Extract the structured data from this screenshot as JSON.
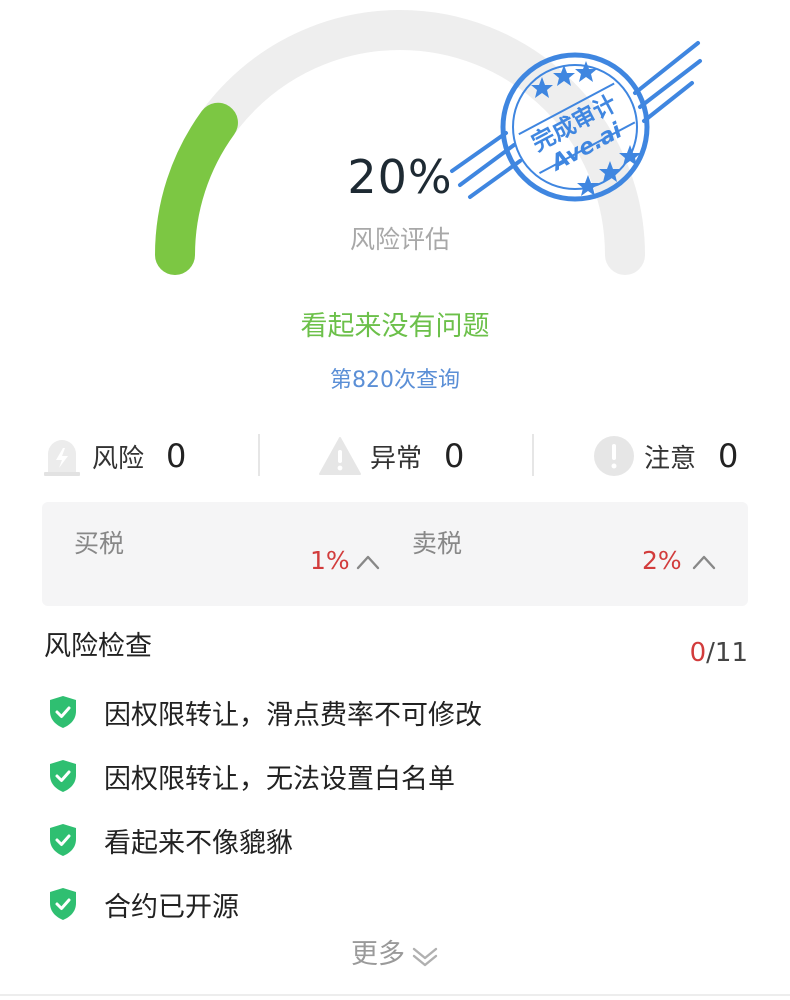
{
  "gauge": {
    "value": "20%",
    "label": "风险评估",
    "fill_fraction": 0.2,
    "track_color": "#eeeeee",
    "fill_color": "#7cc743"
  },
  "stamp": {
    "line1": "完成审计",
    "line2": "Ave.ai",
    "color": "#3f86e0"
  },
  "status": {
    "title": "看起来没有问题",
    "query": "第820次查询"
  },
  "metrics": [
    {
      "label": "风险",
      "count": "0",
      "icon": "siren-icon"
    },
    {
      "label": "异常",
      "count": "0",
      "icon": "warning-triangle-icon"
    },
    {
      "label": "注意",
      "count": "0",
      "icon": "exclamation-circle-icon"
    }
  ],
  "tax": {
    "buy_label": "买税",
    "buy_value": "1%",
    "sell_label": "卖税",
    "sell_value": "2%"
  },
  "risk_check": {
    "title": "风险检查",
    "failed": "0",
    "total": "/11",
    "items": [
      "因权限转让，滑点费率不可修改",
      "因权限转让，无法设置白名单",
      "看起来不像貔貅",
      "合约已开源"
    ]
  },
  "more_label": "更多",
  "colors": {
    "green": "#6cc04a",
    "blue": "#5b8fd6",
    "red": "#d23c3c",
    "shield": "#2fbf71"
  }
}
